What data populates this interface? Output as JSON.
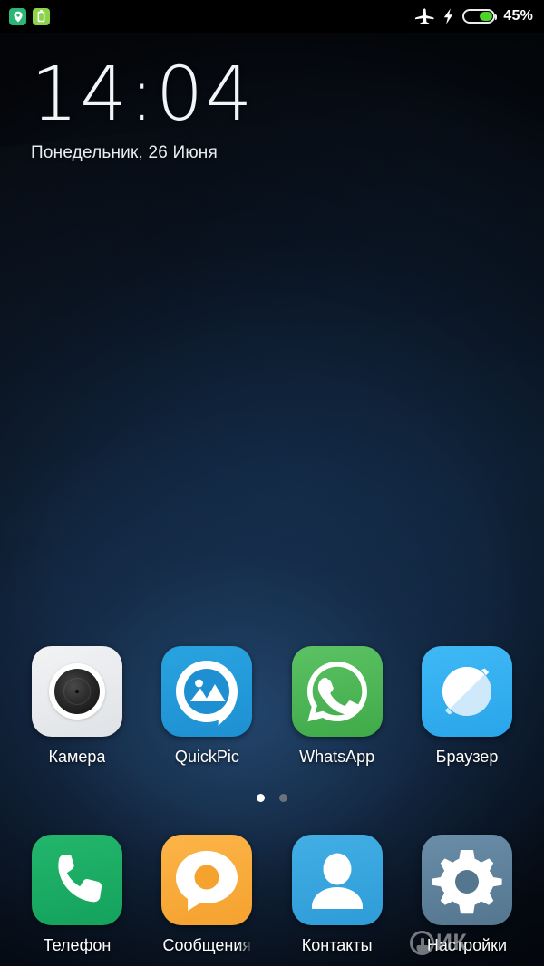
{
  "status_bar": {
    "left_icons": [
      {
        "name": "location-indicator-icon",
        "glyph": "location-pin",
        "color": "#2bb673"
      },
      {
        "name": "battery-saver-icon",
        "glyph": "battery-vertical",
        "color": "#8bd44a"
      }
    ],
    "right_icons": [
      {
        "name": "airplane-mode-icon",
        "glyph": "airplane"
      },
      {
        "name": "charging-bolt-icon",
        "glyph": "lightning-bolt"
      }
    ],
    "battery": {
      "percent_label": "45%",
      "percent_value": 45,
      "fill_color": "#4cd427",
      "outline_color": "#e9ecef"
    }
  },
  "clock_widget": {
    "time": "14:04",
    "date": "Понедельник, 26 Июня"
  },
  "home_screen": {
    "apps_row": [
      {
        "label": "Камера",
        "icon": "camera-icon",
        "color": "#e4e7ea"
      },
      {
        "label": "QuickPic",
        "icon": "gallery-icon",
        "color": "#1e90d2"
      },
      {
        "label": "WhatsApp",
        "icon": "whatsapp-icon",
        "color": "#3faa49"
      },
      {
        "label": "Браузер",
        "icon": "browser-icon",
        "color": "#29a6ea"
      }
    ],
    "dock_row": [
      {
        "label": "Телефон",
        "icon": "phone-icon",
        "color": "#14a25c"
      },
      {
        "label": "Сообщения",
        "icon": "messages-icon",
        "color": "#f5a22f"
      },
      {
        "label": "Контакты",
        "icon": "contacts-icon",
        "color": "#2e9cd8"
      },
      {
        "label": "Настройки",
        "icon": "settings-gear-icon",
        "color": "#54768f"
      }
    ],
    "page_indicator": {
      "total": 2,
      "active_index": 0
    }
  },
  "watermark": {
    "text": "ИК",
    "color": "#c2c5c9"
  }
}
